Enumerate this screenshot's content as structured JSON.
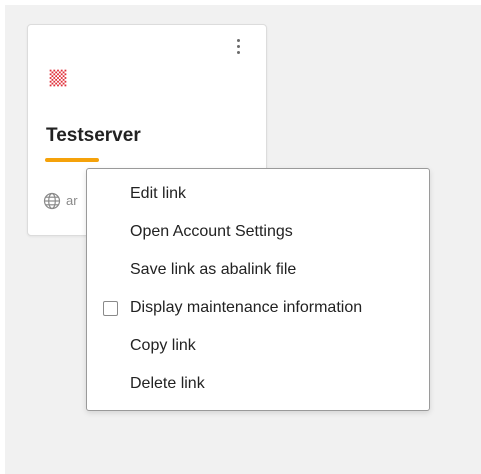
{
  "card": {
    "title": "Testserver",
    "url_prefix": "ar",
    "accent_color": "#f5a20a",
    "logo_color": "#e0303a",
    "icons": {
      "menu": "kebab-menu-icon",
      "logo": "abacus-logo-icon",
      "url": "globe-icon"
    }
  },
  "context_menu": {
    "items": [
      {
        "label": "Edit link"
      },
      {
        "label": "Open Account Settings"
      },
      {
        "label": "Save link as abalink file"
      },
      {
        "label": "Display maintenance information",
        "checkbox": true,
        "checked": false
      },
      {
        "label": "Copy link"
      },
      {
        "label": "Delete link"
      }
    ]
  }
}
